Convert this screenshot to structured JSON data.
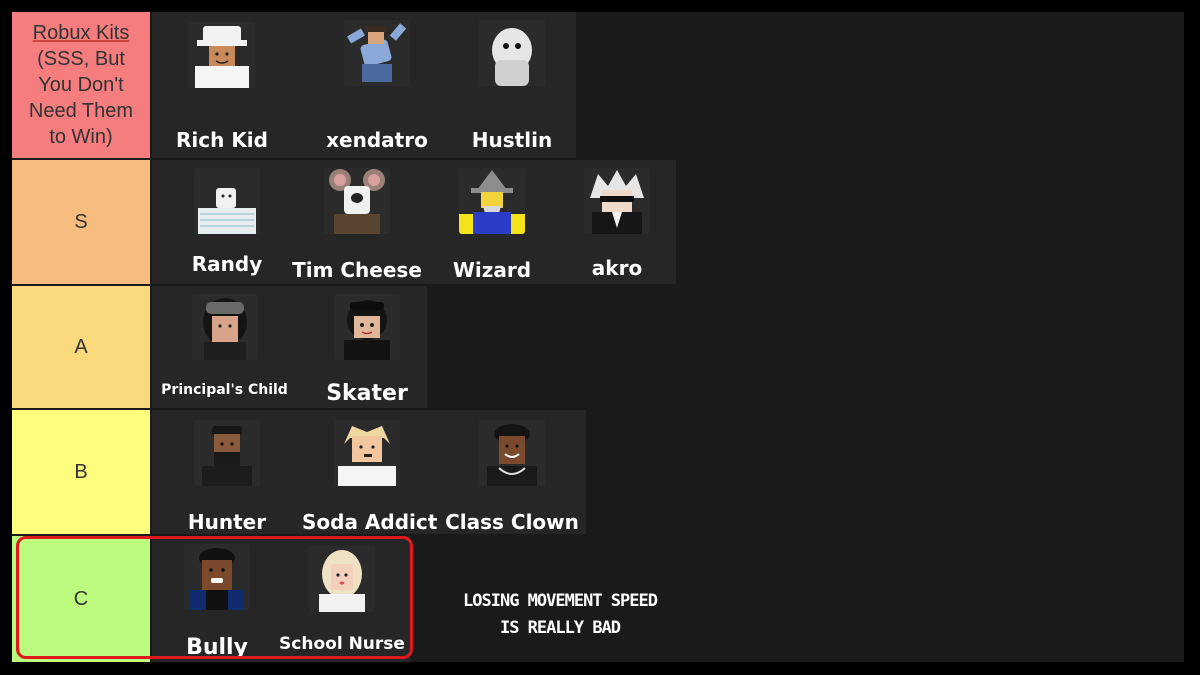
{
  "tiers": [
    {
      "label_lines": [
        "Robux Kits",
        "(SSS, But",
        "You Don't",
        "Need Them",
        "to Win)"
      ],
      "color": "#f57d7d",
      "items": [
        {
          "name": "Rich Kid",
          "icon": "avatar-rich-kid-icon"
        },
        {
          "name": "xendatro",
          "icon": "avatar-xendatro-icon"
        },
        {
          "name": "Hustlin",
          "icon": "avatar-hustlin-icon"
        }
      ]
    },
    {
      "label": "S",
      "color": "#f7bd7e",
      "items": [
        {
          "name": "Randy",
          "icon": "avatar-randy-icon"
        },
        {
          "name": "Tim Cheese",
          "icon": "avatar-tim-cheese-icon"
        },
        {
          "name": "Wizard",
          "icon": "avatar-wizard-icon"
        },
        {
          "name": "akro",
          "icon": "avatar-akro-icon"
        }
      ]
    },
    {
      "label": "A",
      "color": "#fbda7e",
      "items": [
        {
          "name": "Principal's Child",
          "icon": "avatar-principals-child-icon"
        },
        {
          "name": "Skater",
          "icon": "avatar-skater-icon"
        }
      ]
    },
    {
      "label": "B",
      "color": "#fdfd7e",
      "items": [
        {
          "name": "Hunter",
          "icon": "avatar-hunter-icon"
        },
        {
          "name": "Soda Addict",
          "icon": "avatar-soda-addict-icon"
        },
        {
          "name": "Class Clown",
          "icon": "avatar-class-clown-icon"
        }
      ]
    },
    {
      "label": "C",
      "color": "#bdfb7e",
      "items": [
        {
          "name": "Bully",
          "icon": "avatar-bully-icon"
        },
        {
          "name": "School Nurse",
          "icon": "avatar-school-nurse-icon"
        }
      ]
    }
  ],
  "annotation": {
    "lines": [
      "LOSING MOVEMENT SPEED",
      "IS REALLY BAD"
    ],
    "highlight_color": "#e0191f"
  }
}
